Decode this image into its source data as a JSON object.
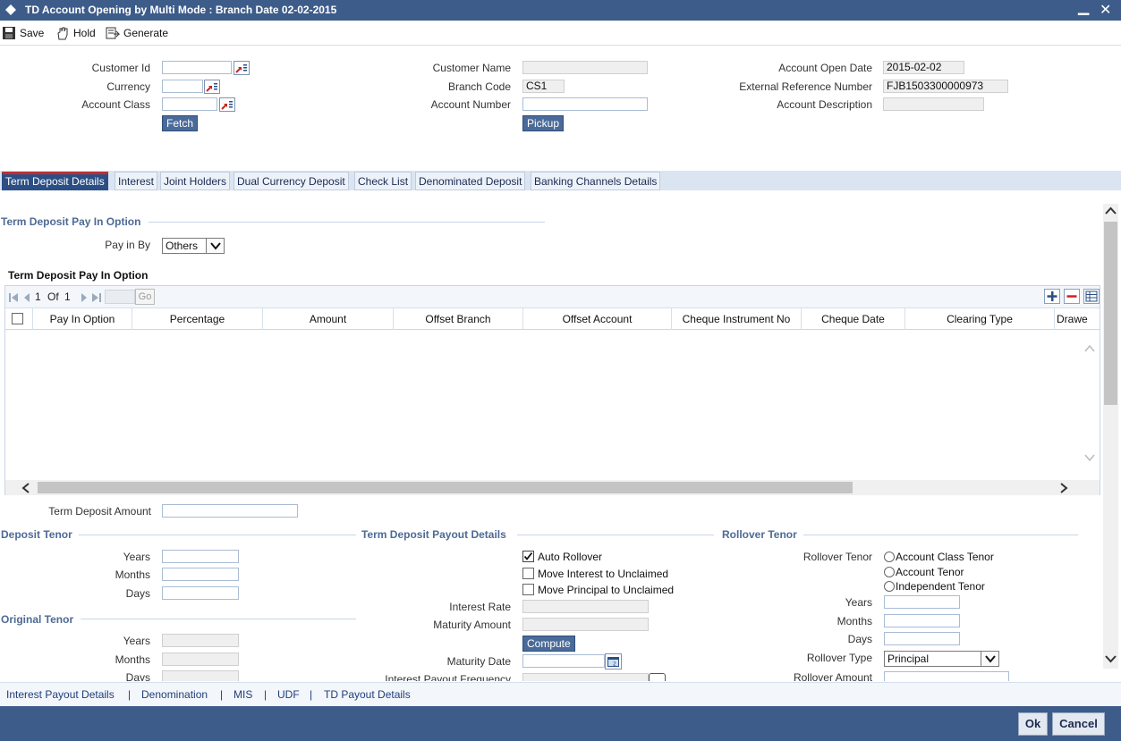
{
  "window": {
    "title": "TD Account Opening by Multi Mode : Branch Date 02-02-2015",
    "minimize": "▁",
    "close": "✕"
  },
  "toolbar": {
    "save": "Save",
    "hold": "Hold",
    "generate": "Generate"
  },
  "header": {
    "customer_id_label": "Customer Id",
    "currency_label": "Currency",
    "account_class_label": "Account Class",
    "fetch": "Fetch",
    "customer_name_label": "Customer Name",
    "branch_code_label": "Branch Code",
    "branch_code_value": "CS1",
    "account_number_label": "Account Number",
    "pickup": "Pickup",
    "open_date_label": "Account Open Date",
    "open_date_value": "2015-02-02",
    "ext_ref_label": "External Reference Number",
    "ext_ref_value": "FJB1503300000973",
    "acc_desc_label": "Account Description"
  },
  "tabs": [
    {
      "label": "Term Deposit Details",
      "active": true
    },
    {
      "label": "Interest"
    },
    {
      "label": "Joint Holders"
    },
    {
      "label": "Dual Currency Deposit"
    },
    {
      "label": "Check List"
    },
    {
      "label": "Denominated Deposit"
    },
    {
      "label": "Banking Channels Details"
    }
  ],
  "payin": {
    "section_title": "Term Deposit Pay In Option",
    "pay_in_by_label": "Pay in By",
    "pay_in_by_value": "Others",
    "grid_title": "Term Deposit Pay In Option",
    "page_current": "1",
    "page_of": "Of",
    "page_total": "1",
    "go": "Go",
    "columns": [
      "Pay In Option",
      "Percentage",
      "Amount",
      "Offset Branch",
      "Offset Account",
      "Cheque Instrument No",
      "Cheque Date",
      "Clearing Type",
      "Drawe"
    ]
  },
  "amount": {
    "label": "Term Deposit Amount"
  },
  "deposit_tenor": {
    "title": "Deposit Tenor",
    "years": "Years",
    "months": "Months",
    "days": "Days"
  },
  "original_tenor": {
    "title": "Original Tenor",
    "years": "Years",
    "months": "Months",
    "days": "Days"
  },
  "payout": {
    "title": "Term Deposit Payout Details",
    "auto_rollover": "Auto Rollover",
    "move_interest": "Move Interest to Unclaimed",
    "move_principal": "Move Principal to Unclaimed",
    "interest_rate": "Interest Rate",
    "maturity_amount": "Maturity Amount",
    "compute": "Compute",
    "maturity_date": "Maturity Date",
    "interest_payout_freq": "Interest Payout Frequency"
  },
  "rollover": {
    "title": "Rollover Tenor",
    "tenor_label": "Rollover Tenor",
    "opt_class": "Account Class Tenor",
    "opt_account": "Account Tenor",
    "opt_independent": "Independent Tenor",
    "years": "Years",
    "months": "Months",
    "days": "Days",
    "type_label": "Rollover Type",
    "type_value": "Principal",
    "amount_label": "Rollover Amount"
  },
  "footer": {
    "links": [
      "Interest Payout Details",
      "Denomination",
      "MIS",
      "UDF",
      "TD Payout Details"
    ],
    "sep": "|",
    "ok": "Ok",
    "cancel": "Cancel"
  },
  "colors": {
    "title_bar": "#3d5c8a",
    "tab_active": "#2b4f85",
    "section_title": "#4d6a95"
  }
}
